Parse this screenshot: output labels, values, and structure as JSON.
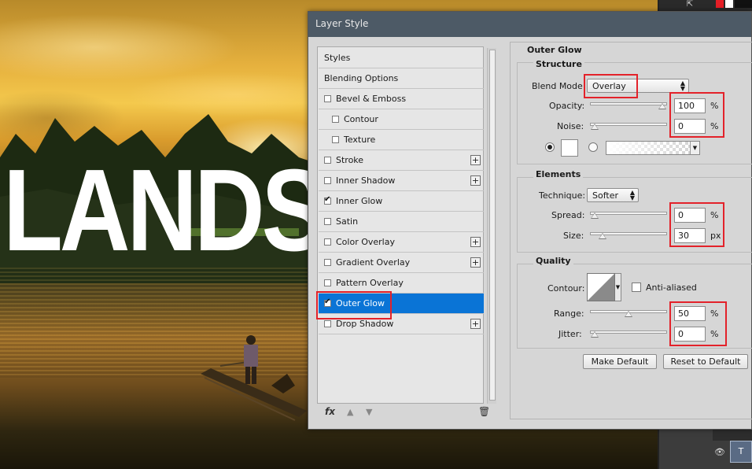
{
  "background": {
    "headline": "LANDS"
  },
  "dialog": {
    "title": "Layer Style",
    "styles_list": [
      {
        "label": "Styles",
        "checkbox": false,
        "checked": false,
        "plus": false,
        "indent": false
      },
      {
        "label": "Blending Options",
        "checkbox": false,
        "checked": false,
        "plus": false,
        "indent": false
      },
      {
        "label": "Bevel & Emboss",
        "checkbox": true,
        "checked": false,
        "plus": false,
        "indent": false
      },
      {
        "label": "Contour",
        "checkbox": true,
        "checked": false,
        "plus": false,
        "indent": true
      },
      {
        "label": "Texture",
        "checkbox": true,
        "checked": false,
        "plus": false,
        "indent": true
      },
      {
        "label": "Stroke",
        "checkbox": true,
        "checked": false,
        "plus": true,
        "indent": false
      },
      {
        "label": "Inner Shadow",
        "checkbox": true,
        "checked": false,
        "plus": true,
        "indent": false
      },
      {
        "label": "Inner Glow",
        "checkbox": true,
        "checked": true,
        "plus": false,
        "indent": false
      },
      {
        "label": "Satin",
        "checkbox": true,
        "checked": false,
        "plus": false,
        "indent": false
      },
      {
        "label": "Color Overlay",
        "checkbox": true,
        "checked": false,
        "plus": true,
        "indent": false
      },
      {
        "label": "Gradient Overlay",
        "checkbox": true,
        "checked": false,
        "plus": true,
        "indent": false
      },
      {
        "label": "Pattern Overlay",
        "checkbox": true,
        "checked": false,
        "plus": false,
        "indent": false
      },
      {
        "label": "Outer Glow",
        "checkbox": true,
        "checked": true,
        "plus": false,
        "indent": false,
        "selected": true
      },
      {
        "label": "Drop Shadow",
        "checkbox": true,
        "checked": false,
        "plus": true,
        "indent": false
      }
    ],
    "footer_icons": {
      "fx": "fx",
      "up": "▲",
      "down": "▼",
      "trash": "🗑"
    },
    "panel": {
      "title": "Outer Glow",
      "structure": {
        "title": "Structure",
        "blend_mode_label": "Blend Mode:",
        "blend_mode_value": "Overlay",
        "opacity_label": "Opacity:",
        "opacity_value": "100",
        "opacity_unit": "%",
        "opacity_level": 1.0,
        "noise_label": "Noise:",
        "noise_value": "0",
        "noise_unit": "%",
        "noise_level": 0.0,
        "color_mode": "solid",
        "glow_color": "#ffffff"
      },
      "elements": {
        "title": "Elements",
        "technique_label": "Technique:",
        "technique_value": "Softer",
        "spread_label": "Spread:",
        "spread_value": "0",
        "spread_unit": "%",
        "spread_level": 0.0,
        "size_label": "Size:",
        "size_value": "30",
        "size_unit": "px",
        "size_level": 0.12
      },
      "quality": {
        "title": "Quality",
        "contour_label": "Contour:",
        "anti_aliased_label": "Anti-aliased",
        "anti_aliased_checked": false,
        "range_label": "Range:",
        "range_value": "50",
        "range_unit": "%",
        "range_level": 0.5,
        "jitter_label": "Jitter:",
        "jitter_value": "0",
        "jitter_unit": "%",
        "jitter_level": 0.0
      },
      "make_default_label": "Make Default",
      "reset_default_label": "Reset to Default"
    }
  },
  "colors": {
    "selection": "#0a74d6",
    "highlight_box": "#e3222a",
    "titlebar": "#4d5a66"
  }
}
